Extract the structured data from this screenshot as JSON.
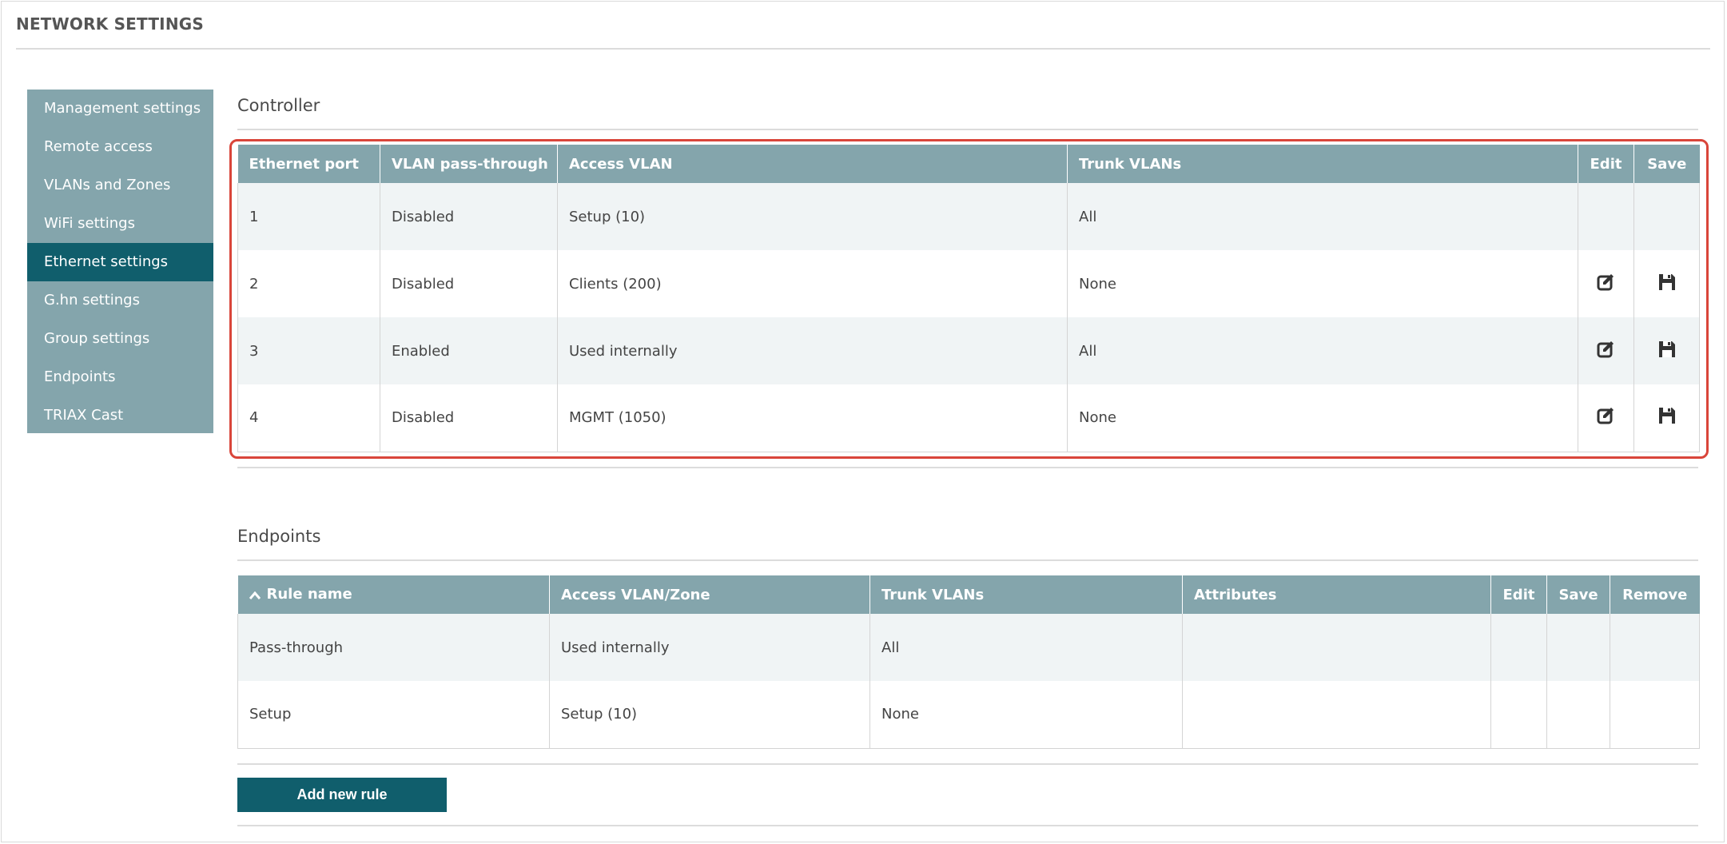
{
  "page": {
    "title": "NETWORK SETTINGS"
  },
  "sidebar": {
    "items": [
      {
        "label": "Management settings"
      },
      {
        "label": "Remote access"
      },
      {
        "label": "VLANs and Zones"
      },
      {
        "label": "WiFi settings"
      },
      {
        "label": "Ethernet settings",
        "active": true
      },
      {
        "label": "G.hn settings"
      },
      {
        "label": "Group settings"
      },
      {
        "label": "Endpoints"
      },
      {
        "label": "TRIAX Cast"
      }
    ]
  },
  "controller": {
    "title": "Controller",
    "columns": [
      "Ethernet port",
      "VLAN pass-through",
      "Access VLAN",
      "Trunk VLANs",
      "Edit",
      "Save"
    ],
    "rows": [
      {
        "port": "1",
        "passthrough": "Disabled",
        "access_vlan": "Setup (10)",
        "trunk_vlans": "All",
        "edit_icon": "",
        "save_icon": ""
      },
      {
        "port": "2",
        "passthrough": "Disabled",
        "access_vlan": "Clients (200)",
        "trunk_vlans": "None",
        "edit_icon": "edit-icon",
        "save_icon": "floppy-save-icon"
      },
      {
        "port": "3",
        "passthrough": "Enabled",
        "access_vlan": "Used internally",
        "trunk_vlans": "All",
        "edit_icon": "edit-icon",
        "save_icon": "floppy-save-icon"
      },
      {
        "port": "4",
        "passthrough": "Disabled",
        "access_vlan": "MGMT (1050)",
        "trunk_vlans": "None",
        "edit_icon": "edit-icon",
        "save_icon": "floppy-save-icon"
      }
    ]
  },
  "endpoints": {
    "title": "Endpoints",
    "sort_icon": "chevron-up-icon",
    "columns": [
      "Rule name",
      "Access VLAN/Zone",
      "Trunk VLANs",
      "Attributes",
      "Edit",
      "Save",
      "Remove"
    ],
    "rows": [
      {
        "rule_name": "Pass-through",
        "access_vlan_zone": "Used internally",
        "trunk_vlans": "All",
        "attributes": ""
      },
      {
        "rule_name": "Setup",
        "access_vlan_zone": "Setup (10)",
        "trunk_vlans": "None",
        "attributes": ""
      }
    ],
    "add_button": "Add new rule"
  },
  "colors": {
    "header_bg": "#84a5ac",
    "active_bg": "#105e6c",
    "highlight_border": "#d9453a",
    "row_alt_bg": "#f0f4f5"
  }
}
